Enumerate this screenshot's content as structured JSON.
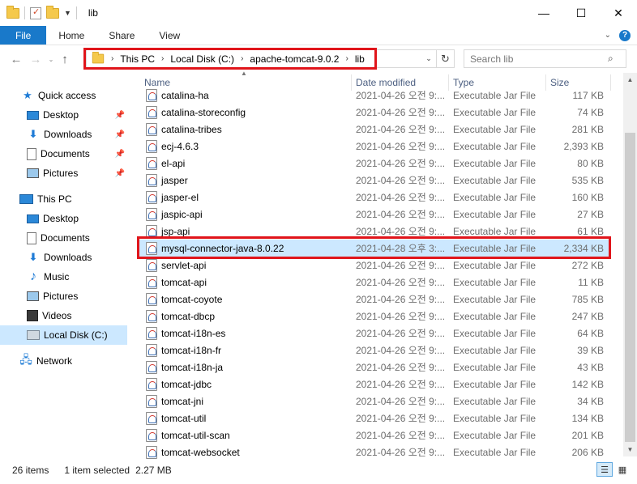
{
  "window": {
    "title": "lib",
    "minimize_icon": "minimize-icon",
    "maximize_icon": "maximize-icon",
    "close_icon": "close-icon"
  },
  "ribbon": {
    "tabs": [
      "File",
      "Home",
      "Share",
      "View"
    ]
  },
  "address": {
    "crumbs": [
      "This PC",
      "Local Disk (C:)",
      "apache-tomcat-9.0.2",
      "lib"
    ]
  },
  "search": {
    "placeholder": "Search lib"
  },
  "nav": {
    "quick_access": "Quick access",
    "qa_items": [
      "Desktop",
      "Downloads",
      "Documents",
      "Pictures"
    ],
    "this_pc": "This PC",
    "pc_items": [
      "Desktop",
      "Documents",
      "Downloads",
      "Music",
      "Pictures",
      "Videos",
      "Local Disk (C:)"
    ],
    "network": "Network"
  },
  "columns": {
    "name": "Name",
    "date": "Date modified",
    "type": "Type",
    "size": "Size"
  },
  "files": [
    {
      "name": "catalina-ha",
      "date": "2021-04-26 오전 9:...",
      "type": "Executable Jar File",
      "size": "117 KB"
    },
    {
      "name": "catalina-storeconfig",
      "date": "2021-04-26 오전 9:...",
      "type": "Executable Jar File",
      "size": "74 KB"
    },
    {
      "name": "catalina-tribes",
      "date": "2021-04-26 오전 9:...",
      "type": "Executable Jar File",
      "size": "281 KB"
    },
    {
      "name": "ecj-4.6.3",
      "date": "2021-04-26 오전 9:...",
      "type": "Executable Jar File",
      "size": "2,393 KB"
    },
    {
      "name": "el-api",
      "date": "2021-04-26 오전 9:...",
      "type": "Executable Jar File",
      "size": "80 KB"
    },
    {
      "name": "jasper",
      "date": "2021-04-26 오전 9:...",
      "type": "Executable Jar File",
      "size": "535 KB"
    },
    {
      "name": "jasper-el",
      "date": "2021-04-26 오전 9:...",
      "type": "Executable Jar File",
      "size": "160 KB"
    },
    {
      "name": "jaspic-api",
      "date": "2021-04-26 오전 9:...",
      "type": "Executable Jar File",
      "size": "27 KB"
    },
    {
      "name": "jsp-api",
      "date": "2021-04-26 오전 9:...",
      "type": "Executable Jar File",
      "size": "61 KB"
    },
    {
      "name": "mysql-connector-java-8.0.22",
      "date": "2021-04-28 오후 3:...",
      "type": "Executable Jar File",
      "size": "2,334 KB"
    },
    {
      "name": "servlet-api",
      "date": "2021-04-26 오전 9:...",
      "type": "Executable Jar File",
      "size": "272 KB"
    },
    {
      "name": "tomcat-api",
      "date": "2021-04-26 오전 9:...",
      "type": "Executable Jar File",
      "size": "11 KB"
    },
    {
      "name": "tomcat-coyote",
      "date": "2021-04-26 오전 9:...",
      "type": "Executable Jar File",
      "size": "785 KB"
    },
    {
      "name": "tomcat-dbcp",
      "date": "2021-04-26 오전 9:...",
      "type": "Executable Jar File",
      "size": "247 KB"
    },
    {
      "name": "tomcat-i18n-es",
      "date": "2021-04-26 오전 9:...",
      "type": "Executable Jar File",
      "size": "64 KB"
    },
    {
      "name": "tomcat-i18n-fr",
      "date": "2021-04-26 오전 9:...",
      "type": "Executable Jar File",
      "size": "39 KB"
    },
    {
      "name": "tomcat-i18n-ja",
      "date": "2021-04-26 오전 9:...",
      "type": "Executable Jar File",
      "size": "43 KB"
    },
    {
      "name": "tomcat-jdbc",
      "date": "2021-04-26 오전 9:...",
      "type": "Executable Jar File",
      "size": "142 KB"
    },
    {
      "name": "tomcat-jni",
      "date": "2021-04-26 오전 9:...",
      "type": "Executable Jar File",
      "size": "34 KB"
    },
    {
      "name": "tomcat-util",
      "date": "2021-04-26 오전 9:...",
      "type": "Executable Jar File",
      "size": "134 KB"
    },
    {
      "name": "tomcat-util-scan",
      "date": "2021-04-26 오전 9:...",
      "type": "Executable Jar File",
      "size": "201 KB"
    },
    {
      "name": "tomcat-websocket",
      "date": "2021-04-26 오전 9:...",
      "type": "Executable Jar File",
      "size": "206 KB"
    }
  ],
  "selected_file": "mysql-connector-java-8.0.22",
  "status": {
    "count": "26 items",
    "selection": "1 item selected",
    "size": "2.27 MB"
  },
  "colors": {
    "accent": "#1979ca",
    "selection": "#cce8ff",
    "highlight_box": "#e0151b"
  }
}
